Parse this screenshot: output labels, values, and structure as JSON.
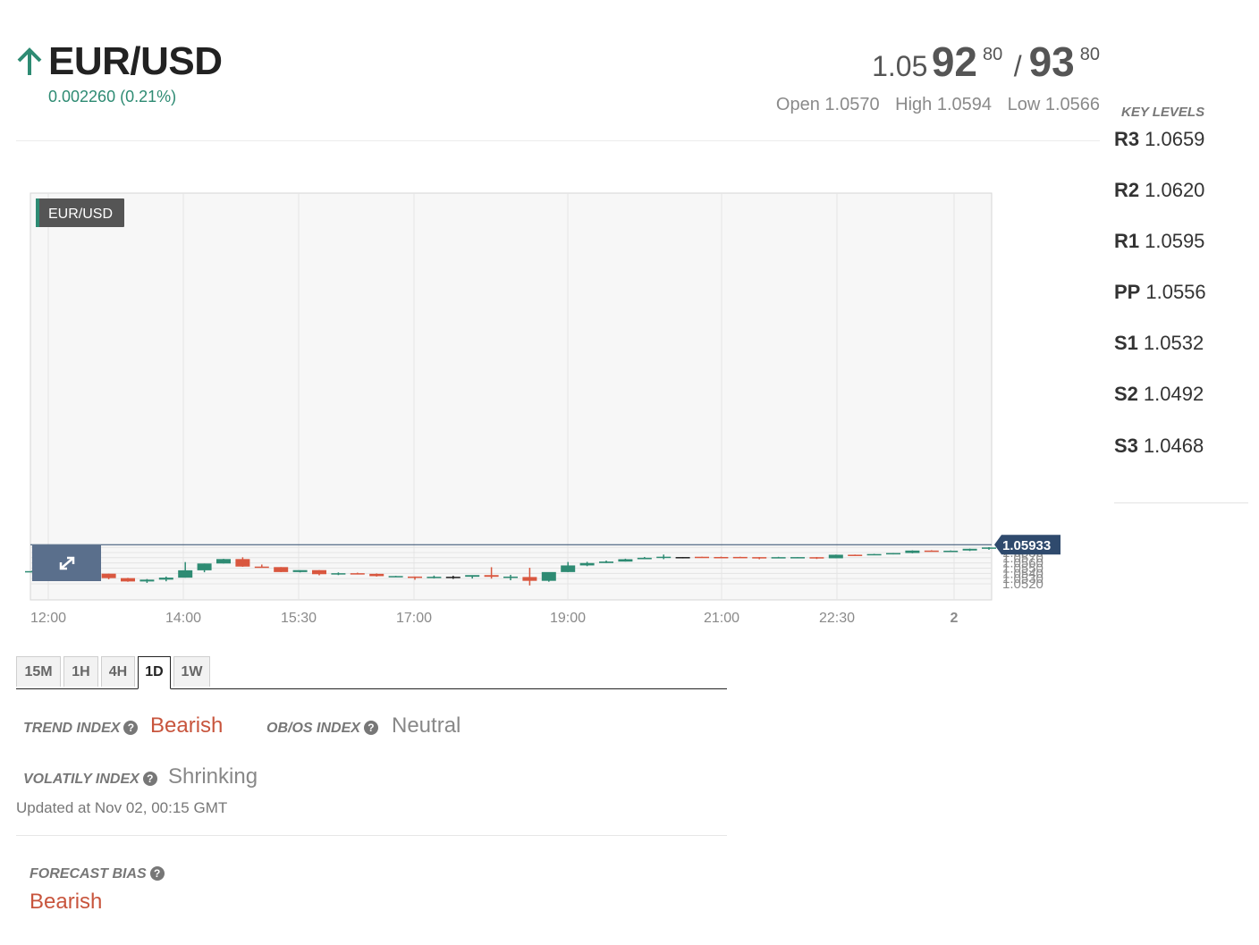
{
  "header": {
    "pair": "EUR/USD",
    "change": "0.002260 (0.21%)",
    "bid_prefix": "1.05",
    "bid_big": "92",
    "bid_pip": "80",
    "slash": "/",
    "ask_big": "93",
    "ask_pip": "80",
    "open": "Open 1.0570",
    "high": "High 1.0594",
    "low": "Low 1.0566"
  },
  "key_levels": {
    "title": "KEY LEVELS",
    "items": [
      {
        "label": "R3",
        "value": "1.0659"
      },
      {
        "label": "R2",
        "value": "1.0620"
      },
      {
        "label": "R1",
        "value": "1.0595"
      },
      {
        "label": "PP",
        "value": "1.0556"
      },
      {
        "label": "S1",
        "value": "1.0532"
      },
      {
        "label": "S2",
        "value": "1.0492"
      },
      {
        "label": "S3",
        "value": "1.0468"
      }
    ]
  },
  "colors": {
    "up": "#2e8b73",
    "down": "#d9573f",
    "neutral_candle": "#222222",
    "price_tag": "#2f4a6d"
  },
  "chart_data": {
    "type": "candlestick",
    "title": "EUR/USD",
    "current_price": "1.05933",
    "ylim": [
      1.0515,
      1.0593
    ],
    "y_ticks": [
      "1.0520",
      "1.0530",
      "1.0540",
      "1.0550",
      "1.0560",
      "1.0570",
      "1.0580",
      "1.0590"
    ],
    "x_ticks": [
      "12:00",
      "14:00",
      "15:30",
      "17:00",
      "19:00",
      "21:00",
      "22:30",
      "2"
    ],
    "candles": [
      {
        "o": 1.05431,
        "h": 1.05451,
        "l": 1.05431,
        "c": 1.05443
      },
      {
        "o": 1.05443,
        "h": 1.05514,
        "l": 1.05428,
        "c": 1.05454
      },
      {
        "o": 1.05454,
        "h": 1.05599,
        "l": 1.05454,
        "c": 1.05485
      },
      {
        "o": 1.05485,
        "h": 1.05528,
        "l": 1.05365,
        "c": 1.05394
      },
      {
        "o": 1.05394,
        "h": 1.05394,
        "l": 1.05288,
        "c": 1.05309
      },
      {
        "o": 1.05309,
        "h": 1.05314,
        "l": 1.05239,
        "c": 1.05245
      },
      {
        "o": 1.05245,
        "h": 1.05291,
        "l": 1.05218,
        "c": 1.0528
      },
      {
        "o": 1.0528,
        "h": 1.05339,
        "l": 1.05248,
        "c": 1.05318
      },
      {
        "o": 1.05318,
        "h": 1.05616,
        "l": 1.05318,
        "c": 1.05459
      },
      {
        "o": 1.05459,
        "h": 1.05588,
        "l": 1.05421,
        "c": 1.05589
      },
      {
        "o": 1.05589,
        "h": 1.05678,
        "l": 1.05589,
        "c": 1.05674
      },
      {
        "o": 1.05674,
        "h": 1.05708,
        "l": 1.05526,
        "c": 1.0553
      },
      {
        "o": 1.0553,
        "h": 1.05569,
        "l": 1.0551,
        "c": 1.0552
      },
      {
        "o": 1.0552,
        "h": 1.0552,
        "l": 1.05423,
        "c": 1.05425
      },
      {
        "o": 1.05425,
        "h": 1.05459,
        "l": 1.05418,
        "c": 1.05462
      },
      {
        "o": 1.05462,
        "h": 1.05462,
        "l": 1.05363,
        "c": 1.05384
      },
      {
        "o": 1.05384,
        "h": 1.05418,
        "l": 1.05367,
        "c": 1.05403
      },
      {
        "o": 1.05403,
        "h": 1.05413,
        "l": 1.05381,
        "c": 1.05391
      },
      {
        "o": 1.05391,
        "h": 1.05398,
        "l": 1.05339,
        "c": 1.05347
      },
      {
        "o": 1.05347,
        "h": 1.05353,
        "l": 1.05333,
        "c": 1.05349
      },
      {
        "o": 1.05339,
        "h": 1.05339,
        "l": 1.05278,
        "c": 1.05313
      },
      {
        "o": 1.05313,
        "h": 1.05357,
        "l": 1.05304,
        "c": 1.05335
      },
      {
        "o": 1.05335,
        "h": 1.05353,
        "l": 1.05294,
        "c": 1.05335
      },
      {
        "o": 1.05335,
        "h": 1.05364,
        "l": 1.05301,
        "c": 1.05367
      },
      {
        "o": 1.05367,
        "h": 1.05518,
        "l": 1.05299,
        "c": 1.05334
      },
      {
        "o": 1.05334,
        "h": 1.05372,
        "l": 1.05268,
        "c": 1.05338
      },
      {
        "o": 1.0533,
        "h": 1.05507,
        "l": 1.05169,
        "c": 1.05257
      },
      {
        "o": 1.05257,
        "h": 1.05421,
        "l": 1.0524,
        "c": 1.05425
      },
      {
        "o": 1.05425,
        "h": 1.05618,
        "l": 1.05425,
        "c": 1.05552
      },
      {
        "o": 1.05552,
        "h": 1.05621,
        "l": 1.05538,
        "c": 1.05598
      },
      {
        "o": 1.05598,
        "h": 1.05645,
        "l": 1.05597,
        "c": 1.05626
      },
      {
        "o": 1.05626,
        "h": 1.05681,
        "l": 1.05626,
        "c": 1.05671
      },
      {
        "o": 1.05671,
        "h": 1.05714,
        "l": 1.05671,
        "c": 1.05699
      },
      {
        "o": 1.05699,
        "h": 1.0576,
        "l": 1.05672,
        "c": 1.05719
      },
      {
        "o": 1.05713,
        "h": 1.05713,
        "l": 1.05687,
        "c": 1.05713
      },
      {
        "o": 1.05718,
        "h": 1.05718,
        "l": 1.05703,
        "c": 1.05714
      },
      {
        "o": 1.05714,
        "h": 1.0572,
        "l": 1.05701,
        "c": 1.0571
      },
      {
        "o": 1.05715,
        "h": 1.05718,
        "l": 1.057,
        "c": 1.05708
      },
      {
        "o": 1.05711,
        "h": 1.05711,
        "l": 1.05671,
        "c": 1.05707
      },
      {
        "o": 1.05707,
        "h": 1.05717,
        "l": 1.05697,
        "c": 1.05711
      },
      {
        "o": 1.05707,
        "h": 1.05712,
        "l": 1.057,
        "c": 1.05712
      },
      {
        "o": 1.0571,
        "h": 1.05712,
        "l": 1.05676,
        "c": 1.05689
      },
      {
        "o": 1.05689,
        "h": 1.0576,
        "l": 1.05689,
        "c": 1.05757
      },
      {
        "o": 1.05757,
        "h": 1.0576,
        "l": 1.05739,
        "c": 1.05751
      },
      {
        "o": 1.05757,
        "h": 1.05774,
        "l": 1.05757,
        "c": 1.0577
      },
      {
        "o": 1.0577,
        "h": 1.05788,
        "l": 1.05764,
        "c": 1.05789
      },
      {
        "o": 1.0579,
        "h": 1.05841,
        "l": 1.05784,
        "c": 1.05837
      },
      {
        "o": 1.05837,
        "h": 1.05843,
        "l": 1.05819,
        "c": 1.05831
      },
      {
        "o": 1.05829,
        "h": 1.05839,
        "l": 1.05819,
        "c": 1.05834
      },
      {
        "o": 1.05838,
        "h": 1.05874,
        "l": 1.05829,
        "c": 1.05871
      },
      {
        "o": 1.05871,
        "h": 1.05902,
        "l": 1.05852,
        "c": 1.05896
      },
      {
        "o": 1.05896,
        "h": 1.05943,
        "l": 1.05896,
        "c": 1.05933
      }
    ]
  },
  "timeframes": [
    "15M",
    "1H",
    "4H",
    "1D",
    "1W"
  ],
  "active_timeframe": "1D",
  "indexes": {
    "trend_label": "TREND INDEX",
    "trend_value": "Bearish",
    "obos_label": "OB/OS INDEX",
    "obos_value": "Neutral",
    "volatility_label": "VOLATILY INDEX",
    "volatility_value": "Shrinking",
    "updated": "Updated at Nov 02, 00:15 GMT",
    "forecast_label": "FORECAST BIAS",
    "forecast_value": "Bearish"
  }
}
